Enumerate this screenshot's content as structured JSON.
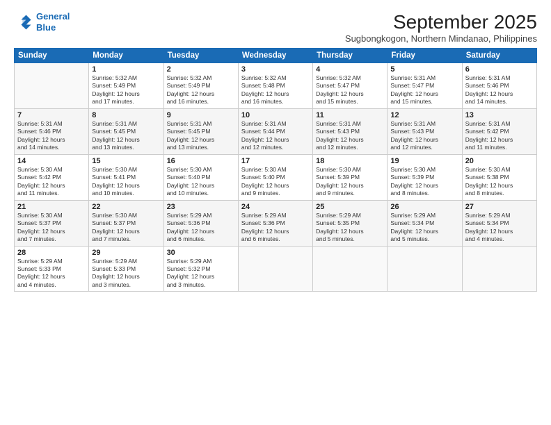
{
  "header": {
    "logo_line1": "General",
    "logo_line2": "Blue",
    "month": "September 2025",
    "location": "Sugbongkogon, Northern Mindanao, Philippines"
  },
  "days_of_week": [
    "Sunday",
    "Monday",
    "Tuesday",
    "Wednesday",
    "Thursday",
    "Friday",
    "Saturday"
  ],
  "weeks": [
    [
      {
        "day": "",
        "info": ""
      },
      {
        "day": "1",
        "info": "Sunrise: 5:32 AM\nSunset: 5:49 PM\nDaylight: 12 hours\nand 17 minutes."
      },
      {
        "day": "2",
        "info": "Sunrise: 5:32 AM\nSunset: 5:49 PM\nDaylight: 12 hours\nand 16 minutes."
      },
      {
        "day": "3",
        "info": "Sunrise: 5:32 AM\nSunset: 5:48 PM\nDaylight: 12 hours\nand 16 minutes."
      },
      {
        "day": "4",
        "info": "Sunrise: 5:32 AM\nSunset: 5:47 PM\nDaylight: 12 hours\nand 15 minutes."
      },
      {
        "day": "5",
        "info": "Sunrise: 5:31 AM\nSunset: 5:47 PM\nDaylight: 12 hours\nand 15 minutes."
      },
      {
        "day": "6",
        "info": "Sunrise: 5:31 AM\nSunset: 5:46 PM\nDaylight: 12 hours\nand 14 minutes."
      }
    ],
    [
      {
        "day": "7",
        "info": "Sunrise: 5:31 AM\nSunset: 5:46 PM\nDaylight: 12 hours\nand 14 minutes."
      },
      {
        "day": "8",
        "info": "Sunrise: 5:31 AM\nSunset: 5:45 PM\nDaylight: 12 hours\nand 13 minutes."
      },
      {
        "day": "9",
        "info": "Sunrise: 5:31 AM\nSunset: 5:45 PM\nDaylight: 12 hours\nand 13 minutes."
      },
      {
        "day": "10",
        "info": "Sunrise: 5:31 AM\nSunset: 5:44 PM\nDaylight: 12 hours\nand 12 minutes."
      },
      {
        "day": "11",
        "info": "Sunrise: 5:31 AM\nSunset: 5:43 PM\nDaylight: 12 hours\nand 12 minutes."
      },
      {
        "day": "12",
        "info": "Sunrise: 5:31 AM\nSunset: 5:43 PM\nDaylight: 12 hours\nand 12 minutes."
      },
      {
        "day": "13",
        "info": "Sunrise: 5:31 AM\nSunset: 5:42 PM\nDaylight: 12 hours\nand 11 minutes."
      }
    ],
    [
      {
        "day": "14",
        "info": "Sunrise: 5:30 AM\nSunset: 5:42 PM\nDaylight: 12 hours\nand 11 minutes."
      },
      {
        "day": "15",
        "info": "Sunrise: 5:30 AM\nSunset: 5:41 PM\nDaylight: 12 hours\nand 10 minutes."
      },
      {
        "day": "16",
        "info": "Sunrise: 5:30 AM\nSunset: 5:40 PM\nDaylight: 12 hours\nand 10 minutes."
      },
      {
        "day": "17",
        "info": "Sunrise: 5:30 AM\nSunset: 5:40 PM\nDaylight: 12 hours\nand 9 minutes."
      },
      {
        "day": "18",
        "info": "Sunrise: 5:30 AM\nSunset: 5:39 PM\nDaylight: 12 hours\nand 9 minutes."
      },
      {
        "day": "19",
        "info": "Sunrise: 5:30 AM\nSunset: 5:39 PM\nDaylight: 12 hours\nand 8 minutes."
      },
      {
        "day": "20",
        "info": "Sunrise: 5:30 AM\nSunset: 5:38 PM\nDaylight: 12 hours\nand 8 minutes."
      }
    ],
    [
      {
        "day": "21",
        "info": "Sunrise: 5:30 AM\nSunset: 5:37 PM\nDaylight: 12 hours\nand 7 minutes."
      },
      {
        "day": "22",
        "info": "Sunrise: 5:30 AM\nSunset: 5:37 PM\nDaylight: 12 hours\nand 7 minutes."
      },
      {
        "day": "23",
        "info": "Sunrise: 5:29 AM\nSunset: 5:36 PM\nDaylight: 12 hours\nand 6 minutes."
      },
      {
        "day": "24",
        "info": "Sunrise: 5:29 AM\nSunset: 5:36 PM\nDaylight: 12 hours\nand 6 minutes."
      },
      {
        "day": "25",
        "info": "Sunrise: 5:29 AM\nSunset: 5:35 PM\nDaylight: 12 hours\nand 5 minutes."
      },
      {
        "day": "26",
        "info": "Sunrise: 5:29 AM\nSunset: 5:34 PM\nDaylight: 12 hours\nand 5 minutes."
      },
      {
        "day": "27",
        "info": "Sunrise: 5:29 AM\nSunset: 5:34 PM\nDaylight: 12 hours\nand 4 minutes."
      }
    ],
    [
      {
        "day": "28",
        "info": "Sunrise: 5:29 AM\nSunset: 5:33 PM\nDaylight: 12 hours\nand 4 minutes."
      },
      {
        "day": "29",
        "info": "Sunrise: 5:29 AM\nSunset: 5:33 PM\nDaylight: 12 hours\nand 3 minutes."
      },
      {
        "day": "30",
        "info": "Sunrise: 5:29 AM\nSunset: 5:32 PM\nDaylight: 12 hours\nand 3 minutes."
      },
      {
        "day": "",
        "info": ""
      },
      {
        "day": "",
        "info": ""
      },
      {
        "day": "",
        "info": ""
      },
      {
        "day": "",
        "info": ""
      }
    ]
  ]
}
